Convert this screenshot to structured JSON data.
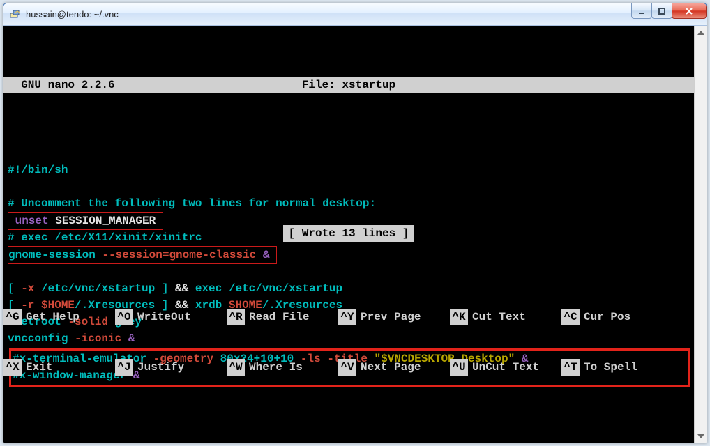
{
  "window": {
    "title": "hussain@tendo: ~/.vnc"
  },
  "nano": {
    "program": "  GNU nano 2.2.6",
    "file_label": "File: xstartup"
  },
  "lines": {
    "l1": "#!/bin/sh",
    "l3": "# Uncomment the following two lines for normal desktop:",
    "l4": {
      "unset": " unset",
      "var": " SESSION_MANAGER "
    },
    "l5": "# exec /etc/X11/xinit/xinitrc",
    "l6": {
      "pre": "gnome-session",
      "opt": " --session=gnome-classic ",
      "amp": "& "
    },
    "l8": {
      "a": "[ ",
      "b": "-x",
      "c": " /etc/vnc/xstartup ] ",
      "d": "&&",
      "e": " exec /etc/vnc/xstartup"
    },
    "l9": {
      "a": "[ ",
      "b": "-r",
      "c": " ",
      "home": "$HOME",
      "d": "/.Xresources ] ",
      "e": "&&",
      "f": " xrdb ",
      "g": "/.Xresources"
    },
    "l10": {
      "a": "xsetroot ",
      "b": "-solid",
      "c": " grey"
    },
    "l11": {
      "a": "vncconfig ",
      "b": "-iconic",
      "c": " ",
      "amp": "&"
    },
    "l12": {
      "hash": "#",
      "a": "x-terminal-emulator ",
      "b": "-geometry",
      "c": " 80x24+10+10 ",
      "d": "-ls",
      "e": " ",
      "f": "-title",
      "g": " ",
      "str": "\"$VNCDESKTOP Desktop\"",
      "amp": " &"
    },
    "l13": {
      "hash": "#",
      "a": "x-window-manager ",
      "amp": "&"
    }
  },
  "status": "[ Wrote 13 lines ]",
  "shortcuts": {
    "r1c1": {
      "k": "^G",
      "l": "Get Help"
    },
    "r1c2": {
      "k": "^O",
      "l": "WriteOut"
    },
    "r1c3": {
      "k": "^R",
      "l": "Read File"
    },
    "r1c4": {
      "k": "^Y",
      "l": "Prev Page"
    },
    "r1c5": {
      "k": "^K",
      "l": "Cut Text"
    },
    "r1c6": {
      "k": "^C",
      "l": "Cur Pos"
    },
    "r2c1": {
      "k": "^X",
      "l": "Exit"
    },
    "r2c2": {
      "k": "^J",
      "l": "Justify"
    },
    "r2c3": {
      "k": "^W",
      "l": "Where Is"
    },
    "r2c4": {
      "k": "^V",
      "l": "Next Page"
    },
    "r2c5": {
      "k": "^U",
      "l": "UnCut Text"
    },
    "r2c6": {
      "k": "^T",
      "l": "To Spell"
    }
  }
}
